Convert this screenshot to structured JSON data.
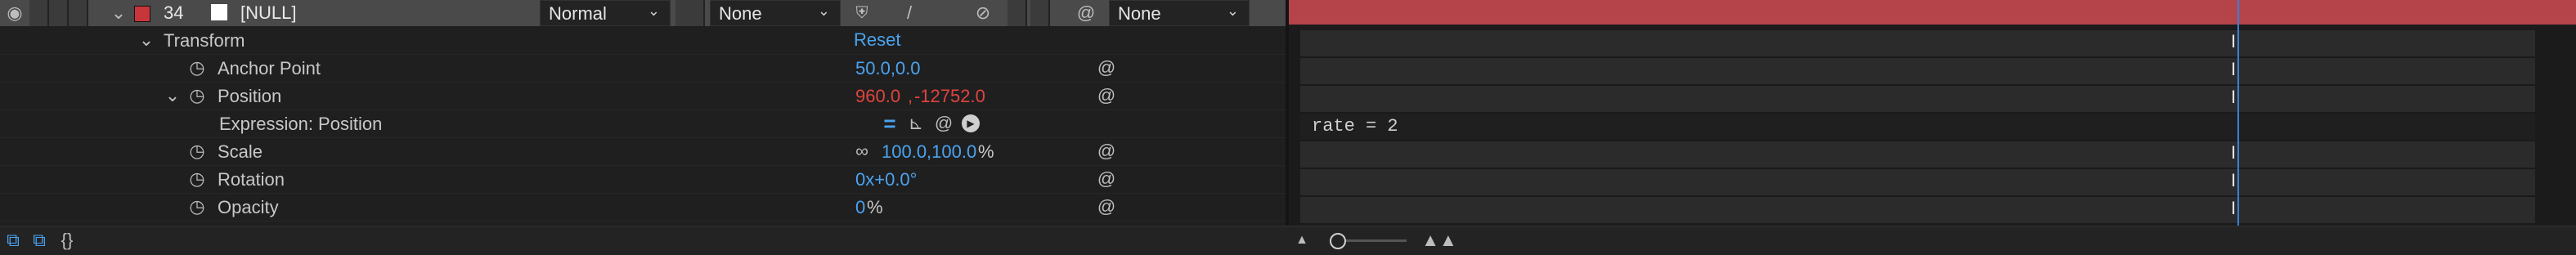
{
  "layer": {
    "number": "34",
    "name": "[NULL]",
    "mode": "Normal",
    "trkmat": "None",
    "parent": "None",
    "label_color": "#c8353a"
  },
  "group": {
    "transform_label": "Transform",
    "reset_label": "Reset"
  },
  "properties": [
    {
      "name": "Anchor Point",
      "value": "50.0,0.0"
    },
    {
      "name": "Position",
      "value_a": "960.0",
      "value_b": "-12752.0"
    },
    {
      "name": "Expression: Position"
    },
    {
      "name": "Scale",
      "value_a": "100.0,100.0",
      "unit": "%"
    },
    {
      "name": "Rotation",
      "value": "0x+0.0°"
    },
    {
      "name": "Opacity",
      "value": "0",
      "unit": "%"
    }
  ],
  "expression": {
    "text": "rate = 2"
  },
  "colors": {
    "accent": "#4aa3f0",
    "expr_red": "#e0443e",
    "layer_bar_red": "#b5444a",
    "cti": "#3a7fd6"
  },
  "icons": [
    "stopwatch-icon",
    "spiral-icon",
    "chain-link-icon",
    "graph-icon",
    "play-icon",
    "pickwhip-icon",
    "equals-icon"
  ]
}
